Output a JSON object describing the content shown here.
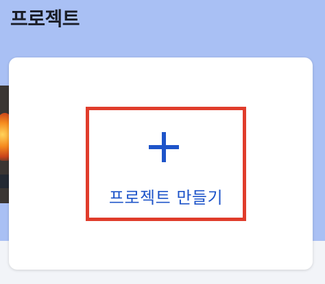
{
  "header": {
    "title": "프로젝트"
  },
  "card": {
    "create_button": {
      "icon": "plus-icon",
      "label": "프로젝트 만들기"
    }
  },
  "colors": {
    "page_background": "#a9c0f4",
    "accent": "#1e54c9",
    "highlight_border": "#e03c2b"
  }
}
